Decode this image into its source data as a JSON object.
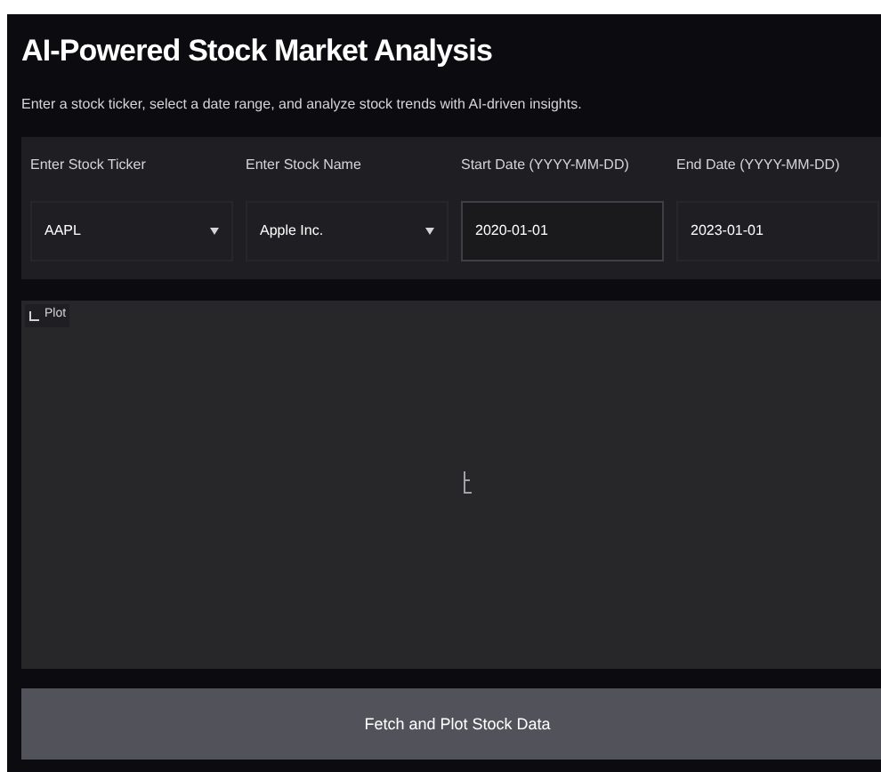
{
  "header": {
    "title": "AI-Powered Stock Market Analysis",
    "subtitle": "Enter a stock ticker, select a date range, and analyze stock trends with AI-driven insights."
  },
  "fields": [
    {
      "kind": "dropdown",
      "label": "Enter Stock Ticker",
      "value": "AAPL",
      "focused": false
    },
    {
      "kind": "dropdown",
      "label": "Enter Stock Name",
      "value": "Apple Inc.",
      "focused": false
    },
    {
      "kind": "text",
      "label": "Start Date (YYYY-MM-DD)",
      "value": "2020-01-01",
      "focused": true
    },
    {
      "kind": "text",
      "label": "End Date (YYYY-MM-DD)",
      "value": "2023-01-01",
      "focused": false
    }
  ],
  "plot": {
    "label": "Plot"
  },
  "button": {
    "label": "Fetch and Plot Stock Data"
  }
}
